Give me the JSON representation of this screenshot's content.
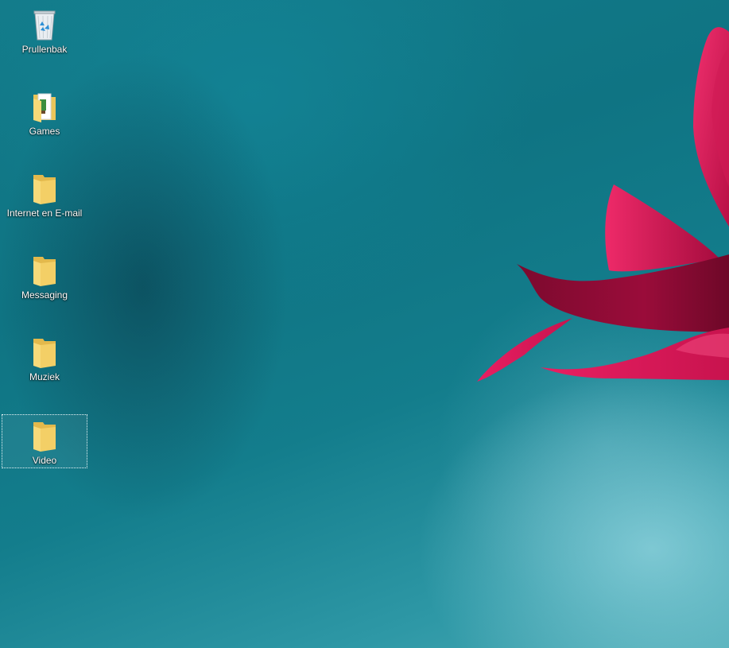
{
  "desktop": {
    "icons": [
      {
        "label": "Prullenbak",
        "icon": "recycle-bin-icon"
      },
      {
        "label": "Games",
        "icon": "folder-icon"
      },
      {
        "label": "Internet en E-mail",
        "icon": "folder-icon"
      },
      {
        "label": "Messaging",
        "icon": "folder-icon"
      },
      {
        "label": "Muziek",
        "icon": "folder-icon"
      },
      {
        "label": "Video",
        "icon": "folder-icon",
        "selected": true
      }
    ]
  },
  "colors": {
    "wallpaper_teal": "#137c8b",
    "flower_pink": "#e0185a",
    "flower_dark": "#8c0a34",
    "folder_yellow": "#f5d76e"
  }
}
